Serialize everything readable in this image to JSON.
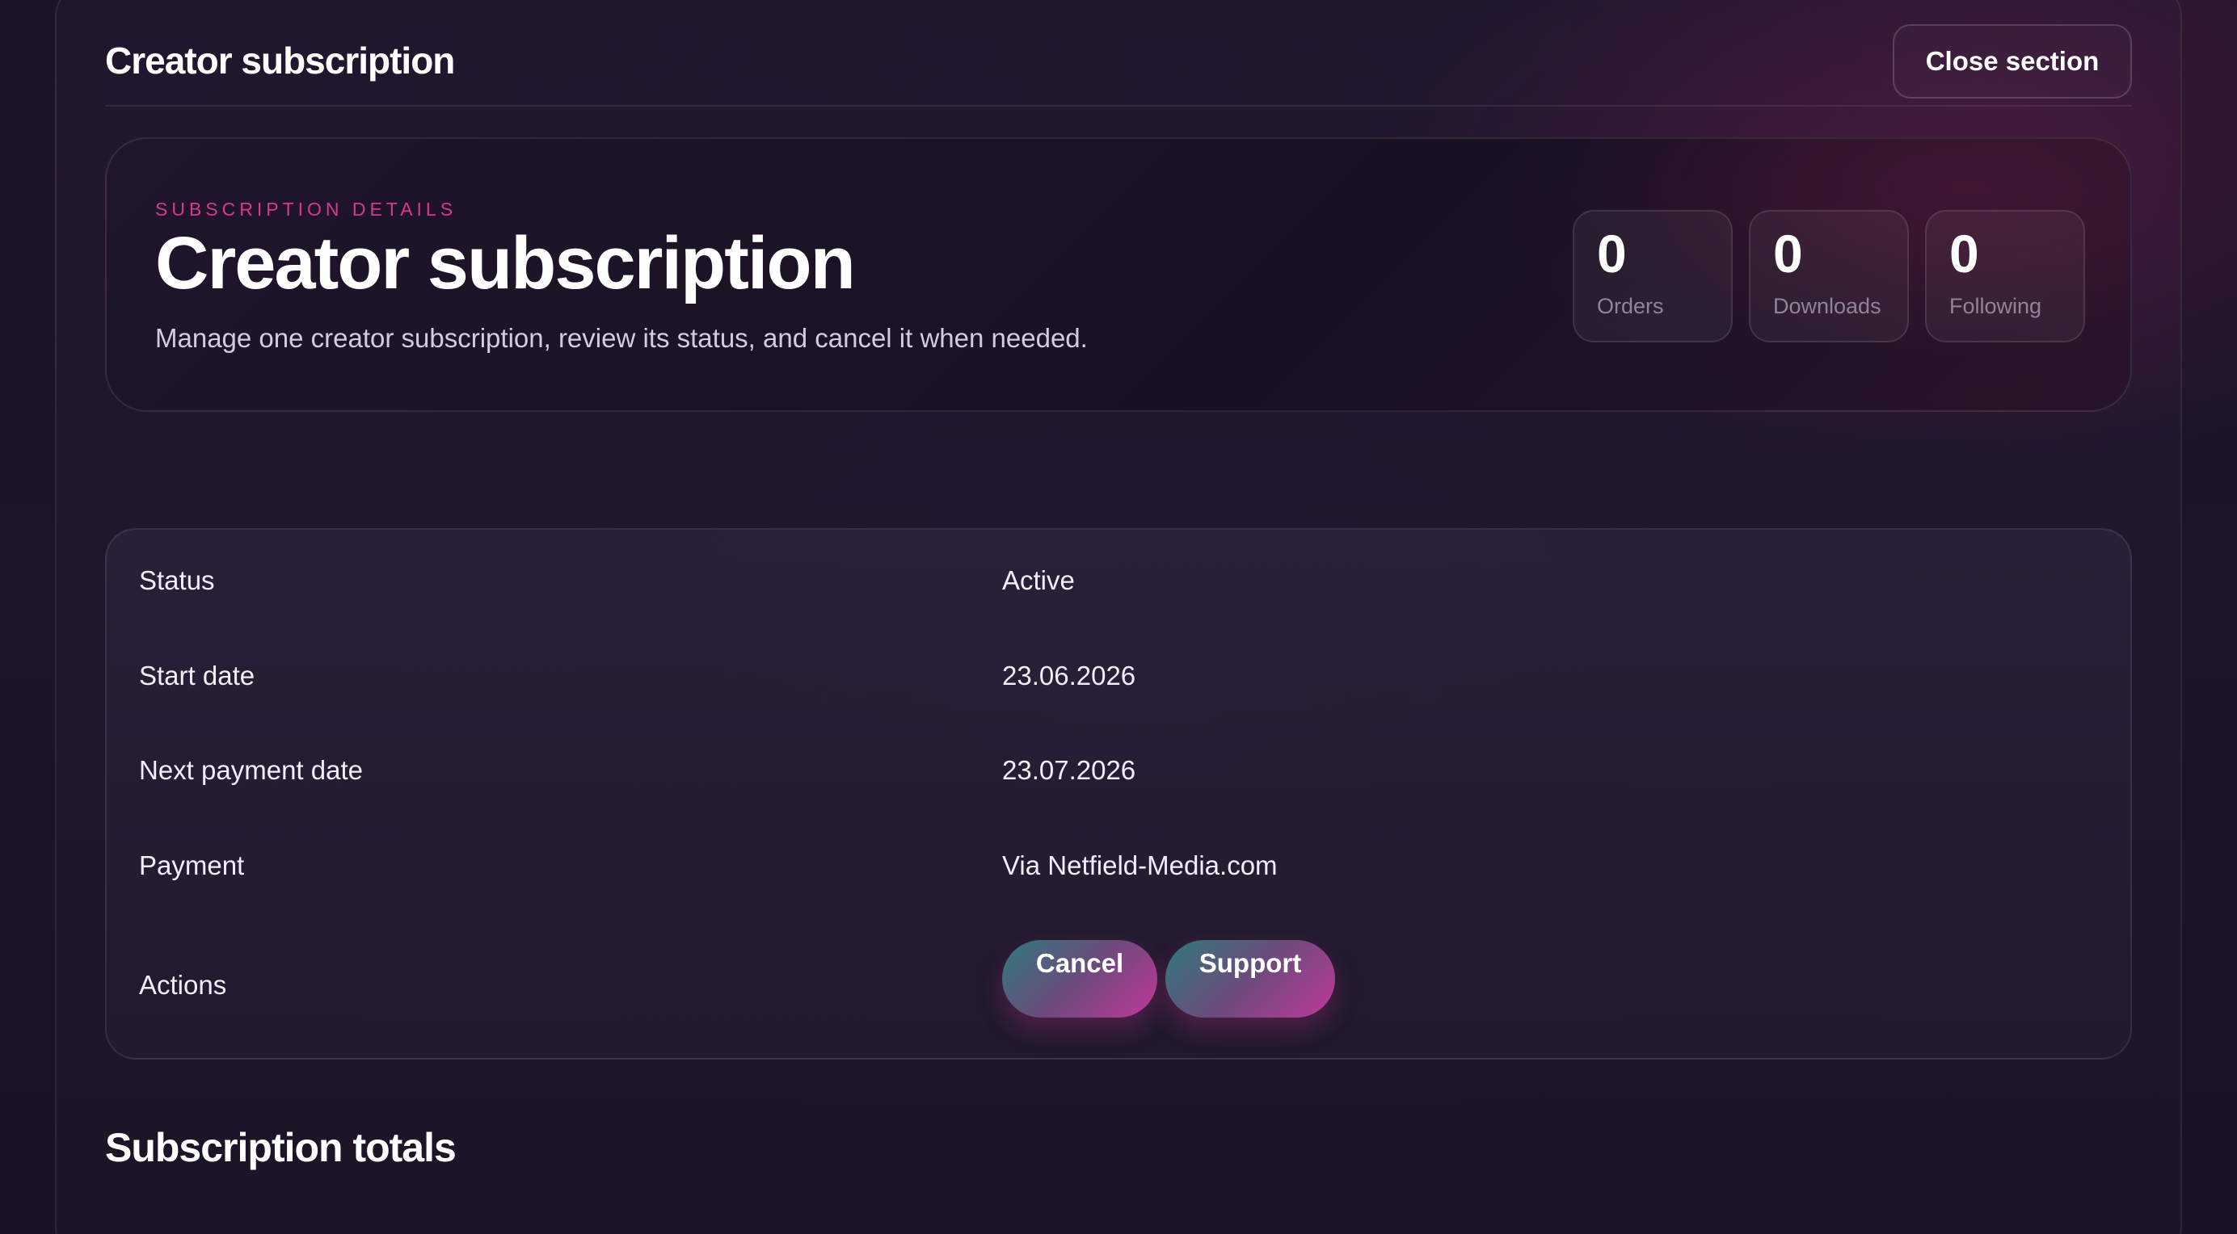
{
  "section": {
    "title": "Creator subscription",
    "close_label": "Close section"
  },
  "hero": {
    "eyebrow": "SUBSCRIPTION DETAILS",
    "title": "Creator subscription",
    "description": "Manage one creator subscription, review its status, and cancel it when needed."
  },
  "stats": [
    {
      "value": "0",
      "label": "Orders"
    },
    {
      "value": "0",
      "label": "Downloads"
    },
    {
      "value": "0",
      "label": "Following"
    }
  ],
  "details": {
    "status_label": "Status",
    "status_value": "Active",
    "start_label": "Start date",
    "start_value": "23.06.2026",
    "next_payment_label": "Next payment date",
    "next_payment_value": "23.07.2026",
    "payment_label": "Payment",
    "payment_value": "Via Netfield-Media.com",
    "actions_label": "Actions",
    "cancel_label": "Cancel",
    "support_label": "Support"
  },
  "totals": {
    "title": "Subscription totals"
  },
  "colors": {
    "accent": "#d6398f",
    "button_gradient_start": "#2f7a7b",
    "button_gradient_end": "#c0399a",
    "background": "#1b1426"
  }
}
